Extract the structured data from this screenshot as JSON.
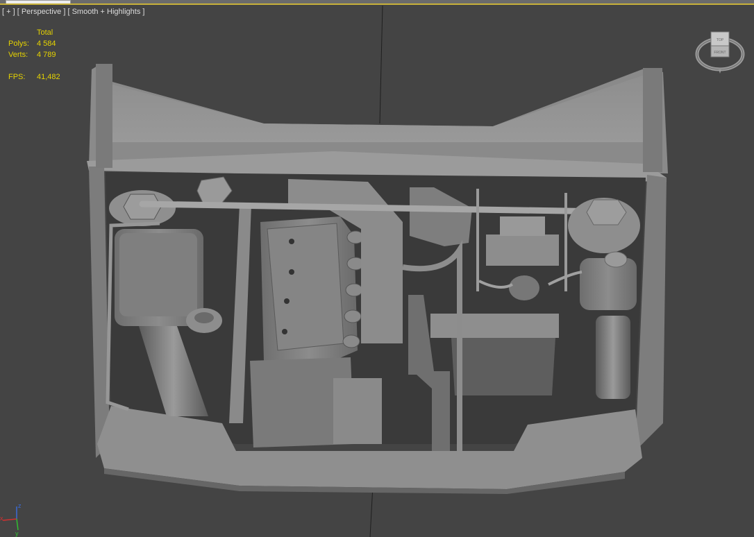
{
  "viewport": {
    "label_plus": "[ + ]",
    "label_view": "[ Perspective ]",
    "label_shading": "[ Smooth + Highlights ]"
  },
  "stats": {
    "header": "Total",
    "polys_label": "Polys:",
    "polys_value": "4 584",
    "verts_label": "Verts:",
    "verts_value": "4 789",
    "fps_label": "FPS:",
    "fps_value": "41,482"
  },
  "viewcube": {
    "face_top": "TOP",
    "face_front": "FRONT"
  },
  "axis_gizmo": {
    "z": "z",
    "x": "x",
    "y": "y"
  },
  "colors": {
    "viewport_bg": "#444444",
    "stats_text": "#e6d300",
    "model_gray": "#8a8a8a"
  }
}
